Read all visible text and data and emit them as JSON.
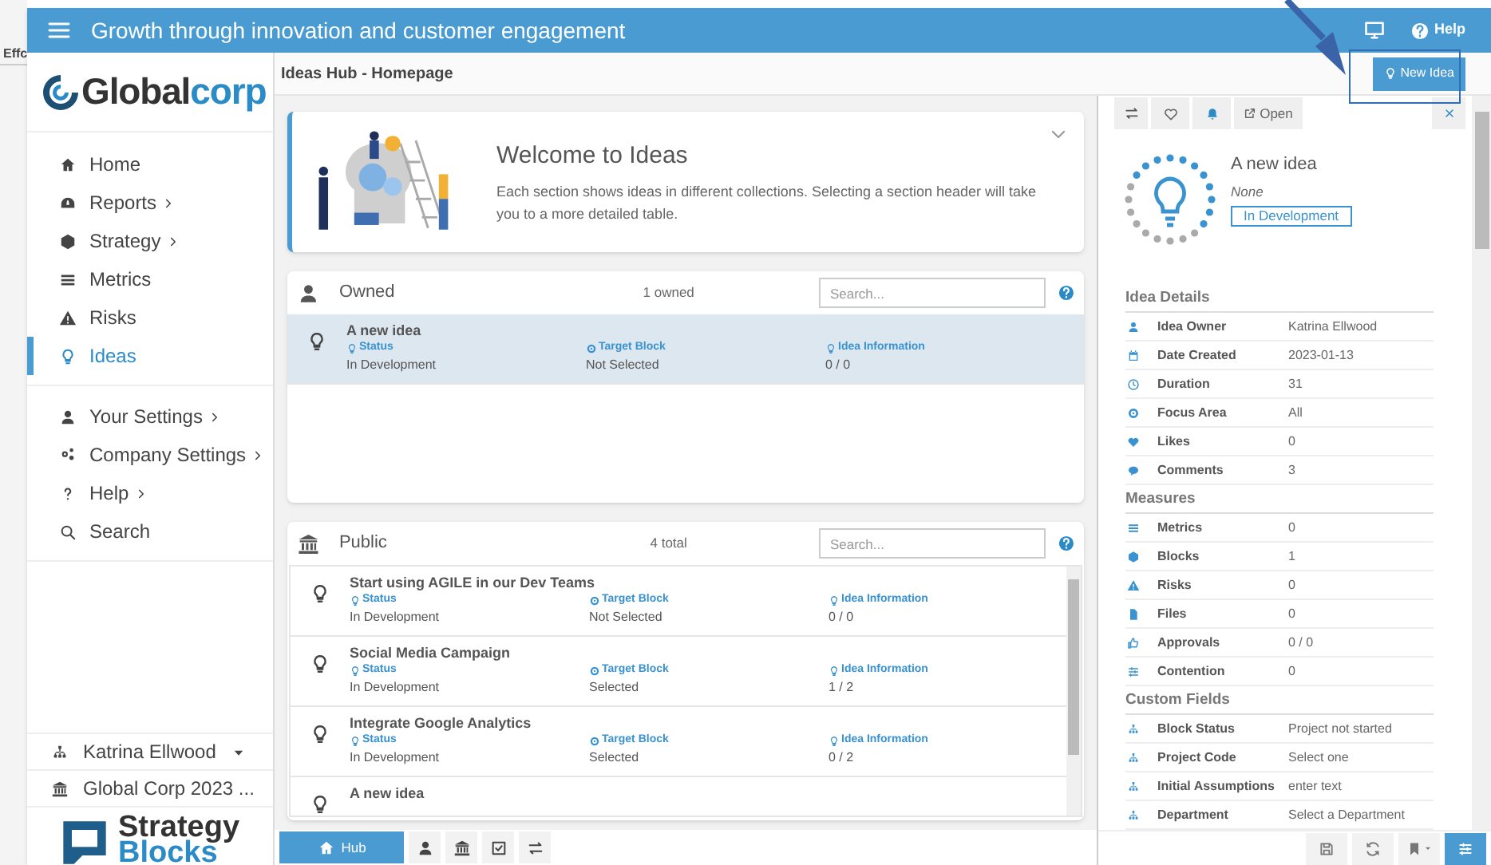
{
  "background_app": {
    "text": "Effc"
  },
  "app_bar": {
    "title": "Growth through innovation and customer engagement",
    "help": "Help"
  },
  "logo": {
    "text_dark": "Global",
    "text_blue": "corp"
  },
  "sidebar": {
    "items": [
      {
        "label": "Home",
        "has_submenu": false,
        "selected": false
      },
      {
        "label": "Reports",
        "has_submenu": true,
        "selected": false
      },
      {
        "label": "Strategy",
        "has_submenu": true,
        "selected": false
      },
      {
        "label": "Metrics",
        "has_submenu": false,
        "selected": false
      },
      {
        "label": "Risks",
        "has_submenu": false,
        "selected": false
      },
      {
        "label": "Ideas",
        "has_submenu": false,
        "selected": true
      }
    ],
    "settings_items": [
      {
        "label": "Your Settings",
        "has_submenu": true
      },
      {
        "label": "Company Settings",
        "has_submenu": true
      },
      {
        "label": "Help",
        "has_submenu": true
      },
      {
        "label": "Search",
        "has_submenu": false
      }
    ],
    "user": "Katrina Ellwood",
    "organisation": "Global Corp 2023 ...",
    "brand": {
      "line1": "Strategy",
      "line2": "Blocks"
    }
  },
  "page_title": "Ideas Hub - Homepage",
  "new_idea_button": "New Idea",
  "welcome": {
    "title": "Welcome to Ideas",
    "text": "Each section shows ideas in different collections. Selecting a section header will take you to a more detailed table."
  },
  "sections": [
    {
      "title": "Owned",
      "count": "1 owned",
      "search_placeholder": "Search...",
      "rows": [
        {
          "title": "A new idea",
          "selected": true,
          "fields": [
            {
              "label": "Status",
              "value": "In Development"
            },
            {
              "label": "Target Block",
              "value": "Not Selected"
            },
            {
              "label": "Idea Information",
              "value": "0 / 0"
            }
          ]
        }
      ]
    },
    {
      "title": "Public",
      "count": "4 total",
      "search_placeholder": "Search...",
      "rows": [
        {
          "title": "Start using AGILE in our Dev Teams",
          "selected": false,
          "fields": [
            {
              "label": "Status",
              "value": "In Development"
            },
            {
              "label": "Target Block",
              "value": "Not Selected"
            },
            {
              "label": "Idea Information",
              "value": "0 / 0"
            }
          ]
        },
        {
          "title": "Social Media Campaign",
          "selected": false,
          "fields": [
            {
              "label": "Status",
              "value": "In Development"
            },
            {
              "label": "Target Block",
              "value": "Selected"
            },
            {
              "label": "Idea Information",
              "value": "1 / 2"
            }
          ]
        },
        {
          "title": "Integrate Google Analytics",
          "selected": false,
          "fields": [
            {
              "label": "Status",
              "value": "In Development"
            },
            {
              "label": "Target Block",
              "value": "Selected"
            },
            {
              "label": "Idea Information",
              "value": "0 / 2"
            }
          ]
        },
        {
          "title": "A new idea",
          "selected": false
        }
      ]
    }
  ],
  "footer_tabs": [
    {
      "label": "Hub",
      "selected": true
    },
    {
      "selected": false
    },
    {
      "selected": false
    },
    {
      "selected": false
    },
    {
      "selected": false
    }
  ],
  "footer_tools": [
    {
      "selected": false
    },
    {
      "selected": false
    },
    {
      "selected": false
    },
    {
      "selected": true
    }
  ],
  "detail_panel": {
    "open_button": "Open",
    "title": "A new idea",
    "subtitle": "None",
    "status": "In Development",
    "groups": [
      {
        "heading": "Idea Details",
        "rows": [
          {
            "label": "Idea Owner",
            "value": "Katrina Ellwood"
          },
          {
            "label": "Date Created",
            "value": "2023-01-13"
          },
          {
            "label": "Duration",
            "value": "31"
          },
          {
            "label": "Focus Area",
            "value": "All"
          },
          {
            "label": "Likes",
            "value": "0"
          },
          {
            "label": "Comments",
            "value": "3"
          }
        ]
      },
      {
        "heading": "Measures",
        "rows": [
          {
            "label": "Metrics",
            "value": "0"
          },
          {
            "label": "Blocks",
            "value": "1"
          },
          {
            "label": "Risks",
            "value": "0"
          },
          {
            "label": "Files",
            "value": "0"
          },
          {
            "label": "Approvals",
            "value": "0 / 0"
          },
          {
            "label": "Contention",
            "value": "0"
          }
        ]
      },
      {
        "heading": "Custom Fields",
        "rows": [
          {
            "label": "Block Status",
            "value": "Project not started"
          },
          {
            "label": "Project Code",
            "value": "Select one"
          },
          {
            "label": "Initial Assumptions",
            "value": "enter text"
          },
          {
            "label": "Department",
            "value": "Select a Department"
          }
        ]
      }
    ]
  }
}
